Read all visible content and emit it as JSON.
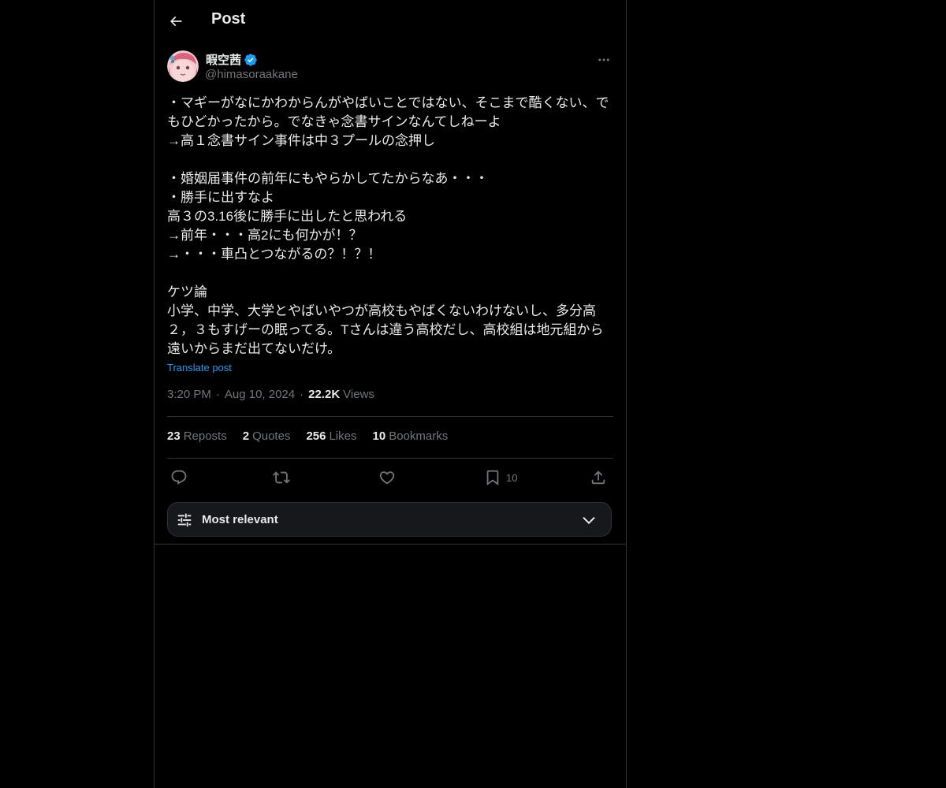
{
  "header": {
    "title": "Post"
  },
  "author": {
    "display_name": "暇空茜",
    "handle": "@himasoraakane",
    "verified": true
  },
  "post": {
    "lines": [
      "・マギーがなにかわからんがやばいことではない、そこまで酷くない、で",
      "もひどかったから。でなきゃ念書サインなんてしねーよ",
      "→高１念書サイン事件は中３プールの念押し",
      "",
      "・婚姻届事件の前年にもやらかしてたからなあ・・・",
      "・勝手に出すなよ",
      "高３の3.16後に勝手に出したと思われる",
      "→前年・・・高2にも何かが！？",
      "→・・・車凸とつながるの？！？！",
      "",
      "ケツ論",
      "小学、中学、大学とやばいやつが高校もやばくないわけないし、多分高",
      "２，３もすげーの眠ってる。Tさんは違う高校だし、高校組は地元組から",
      "遠いからまだ出てないだけ。"
    ],
    "translate_label": "Translate post",
    "time": "3:20 PM",
    "date": "Aug 10, 2024",
    "views_count": "22.2K",
    "views_label": "Views",
    "separator": "·"
  },
  "stats": {
    "reposts_count": "23",
    "reposts_label": "Reposts",
    "quotes_count": "2",
    "quotes_label": "Quotes",
    "likes_count": "256",
    "likes_label": "Likes",
    "bookmarks_count": "10",
    "bookmarks_label": "Bookmarks"
  },
  "actions": {
    "bookmark_count": "10"
  },
  "sort": {
    "label": "Most relevant"
  },
  "colors": {
    "background": "#000000",
    "text_primary": "#e7e9ea",
    "text_secondary": "#71767b",
    "accent": "#1d9bf0",
    "border": "#2f3336",
    "sort_bar_bg": "#16181c"
  },
  "icons": {
    "back": "arrow-left-icon",
    "verified": "verified-badge-icon",
    "more": "more-dots-icon",
    "reply": "reply-icon",
    "repost": "repost-icon",
    "like": "heart-icon",
    "bookmark": "bookmark-icon",
    "share": "share-icon",
    "sort": "sliders-icon",
    "chevron": "chevron-down-icon"
  }
}
